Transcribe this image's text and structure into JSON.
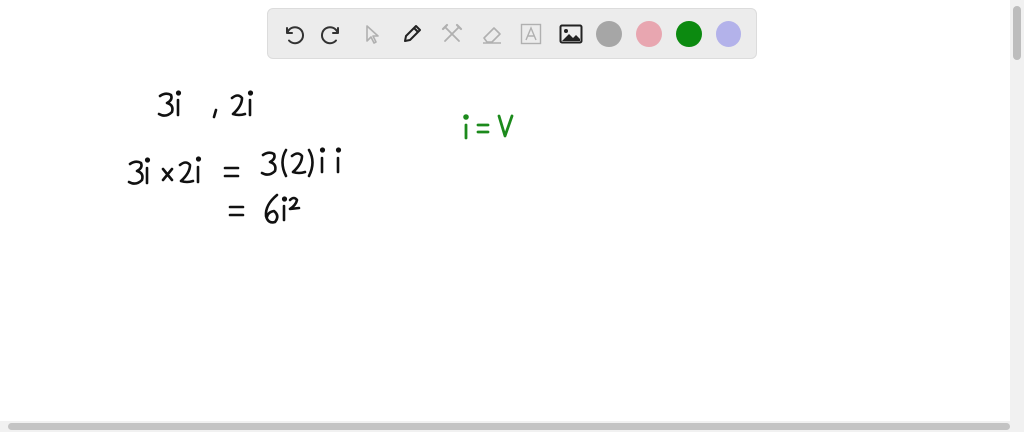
{
  "toolbar": {
    "tools": [
      {
        "name": "undo-icon",
        "enabled": true
      },
      {
        "name": "redo-icon",
        "enabled": true
      },
      {
        "name": "pointer-icon",
        "enabled": false
      },
      {
        "name": "pencil-icon",
        "enabled": true
      },
      {
        "name": "tools-icon",
        "enabled": false
      },
      {
        "name": "eraser-icon",
        "enabled": false
      },
      {
        "name": "text-icon",
        "enabled": false
      },
      {
        "name": "image-icon",
        "enabled": true
      }
    ],
    "colors": [
      "#a6a6a6",
      "#e8a6b0",
      "#0c8a10",
      "#b3b2ea"
    ]
  },
  "canvas": {
    "ink_black": "#111111",
    "ink_green": "#1c8a1c"
  }
}
